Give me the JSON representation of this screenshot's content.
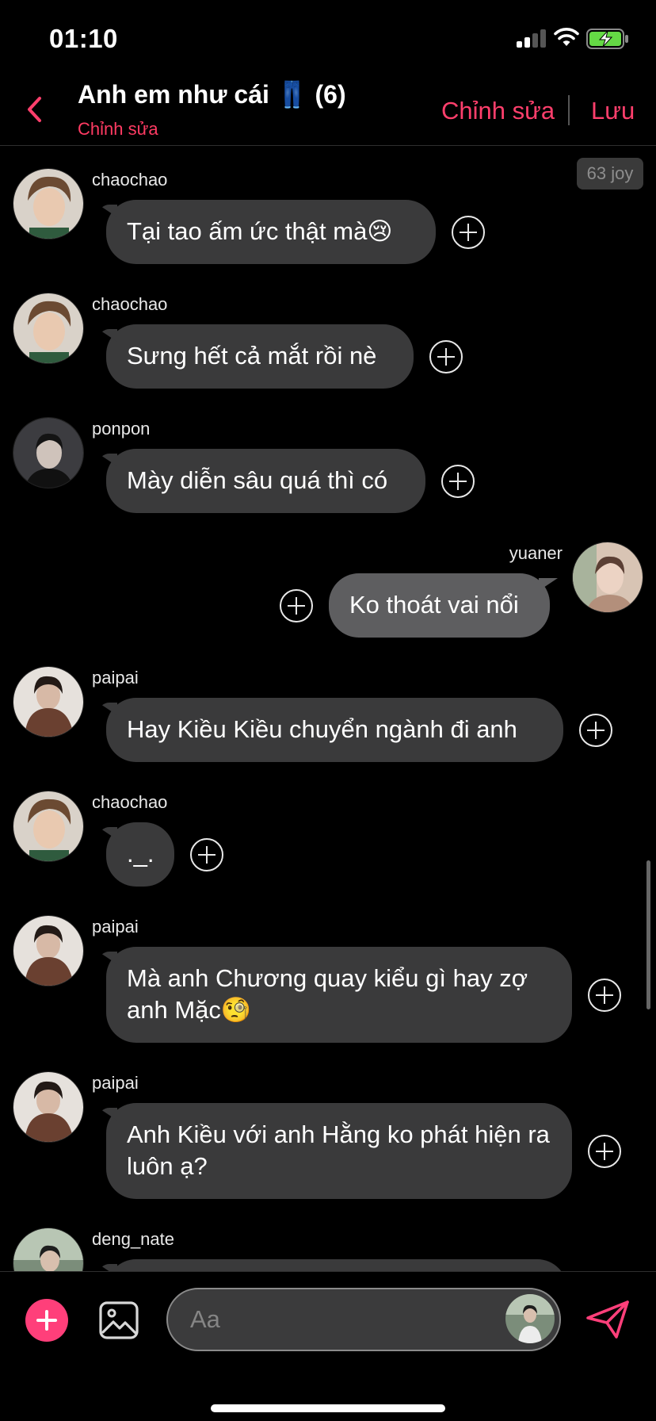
{
  "status_bar": {
    "time": "01:10",
    "signal_bars": 2,
    "signal_max_bars": 4,
    "battery_charging": true,
    "battery_color": "#65d945"
  },
  "header": {
    "title": "Anh em như cái 👖 (6)",
    "subtitle": "Chỉnh sửa",
    "edit_label": "Chỉnh sửa",
    "save_label": "Lưu",
    "accent_color": "#ff3f6c",
    "back_icon": "chevron-left-icon"
  },
  "badge": "63 joy",
  "messages": [
    {
      "user": "chaochao",
      "text": "Tại tao ấm ức thật mà😢",
      "direction": "in",
      "avatar": "chaochao"
    },
    {
      "user": "chaochao",
      "text": "Sưng hết cả mắt rồi nè",
      "direction": "in",
      "avatar": "chaochao"
    },
    {
      "user": "ponpon",
      "text": "Mày diễn sâu quá thì có",
      "direction": "in",
      "avatar": "ponpon"
    },
    {
      "user": "yuaner",
      "text": "Ko thoát vai nổi",
      "direction": "out",
      "avatar": "yuaner"
    },
    {
      "user": "paipai",
      "text": "Hay Kiều Kiều chuyển ngành đi anh",
      "direction": "in",
      "avatar": "paipai"
    },
    {
      "user": "chaochao",
      "text": "._.",
      "direction": "in",
      "avatar": "chaochao"
    },
    {
      "user": "paipai",
      "text": "Mà anh Chương quay kiểu gì hay zợ anh Mặc🧐",
      "direction": "in",
      "avatar": "paipai"
    },
    {
      "user": "paipai",
      "text": "Anh Kiều với anh Hằng ko phát hiện ra luôn ạ?",
      "direction": "in",
      "avatar": "paipai"
    },
    {
      "user": "deng_nate",
      "text": "",
      "direction": "in",
      "avatar": "deng_nate"
    }
  ],
  "composer": {
    "placeholder": "Aa",
    "add_icon": "plus-icon",
    "image_icon": "image-icon",
    "send_icon": "send-icon",
    "add_color": "#ff3f7a"
  }
}
